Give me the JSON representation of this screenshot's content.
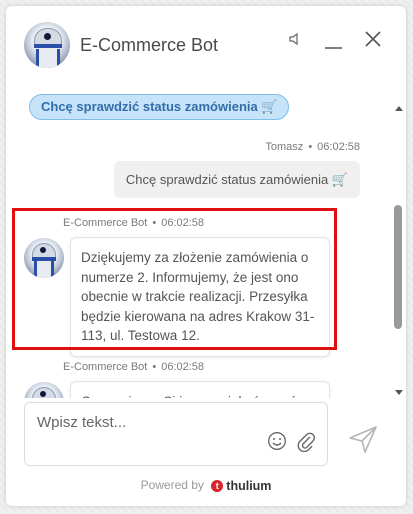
{
  "header": {
    "title": "E-Commerce Bot",
    "icons": {
      "speaker": "speaker-icon",
      "minimize": "minimize-icon",
      "close": "close-icon"
    }
  },
  "quick_reply": {
    "label": "Chcę sprawdzić status zamówienia 🛒"
  },
  "messages": [
    {
      "sender": "Tomasz",
      "time": "06:02:58",
      "text": "Chcę sprawdzić status zamówienia 🛒",
      "type": "user"
    },
    {
      "sender": "E-Commerce Bot",
      "time": "06:02:58",
      "text": "Dziękujemy za złożenie zamówienia o numerze 2. Informujemy, że jest ono obecnie w trakcie realizacji. Przesyłka będzie kierowana na adres Krakow 31-113, ul. Testowa 12.",
      "type": "bot"
    },
    {
      "sender": "E-Commerce Bot",
      "time": "06:02:58",
      "text": "Czy możemy Ci jeszcze jakoś pomóc",
      "type": "bot"
    }
  ],
  "composer": {
    "placeholder": "Wpisz tekst...",
    "value": ""
  },
  "footer": {
    "powered_label": "Powered by",
    "brand": "thulium"
  },
  "colors": {
    "quick_reply_bg": "#c6e3fa",
    "quick_reply_border": "#7fbfe9",
    "quick_reply_text": "#336ea8",
    "highlight": "#e01010",
    "brand_logo": "#d9242b"
  }
}
